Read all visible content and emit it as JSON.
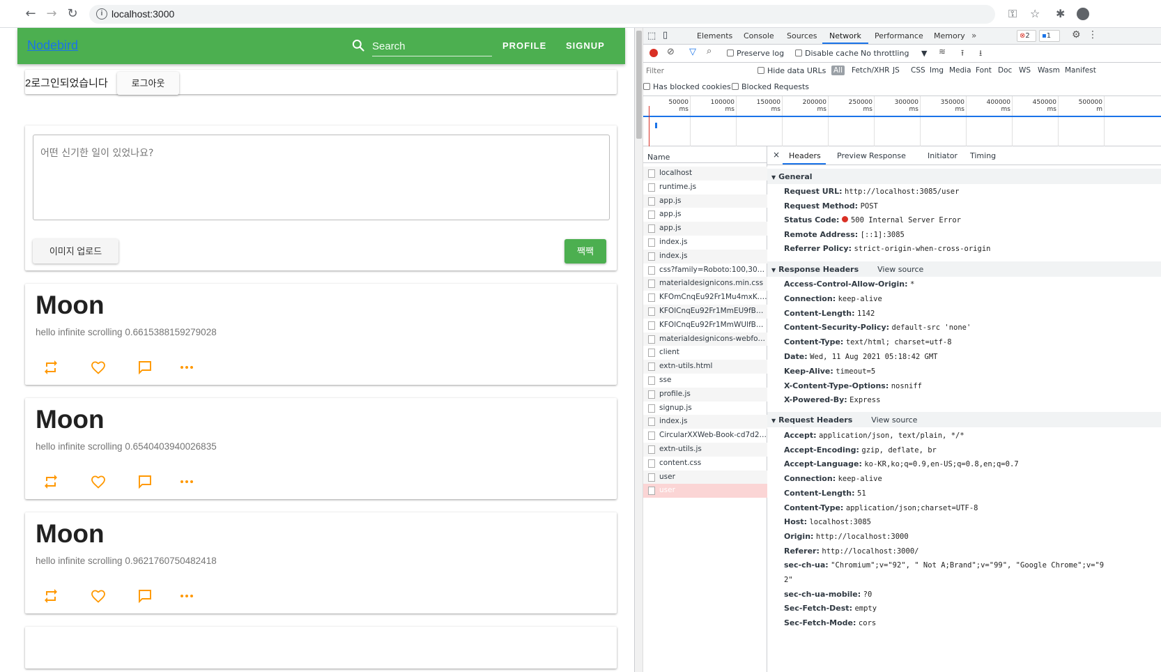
{
  "browser": {
    "url": "localhost:3000"
  },
  "app": {
    "brand": "Nodebird",
    "search_placeholder": "Search",
    "nav": {
      "profile": "PROFILE",
      "signup": "SIGNUP"
    },
    "login_text": "2로그인되었습니다",
    "logout_label": "로그아웃",
    "post_placeholder": "어떤 신기한 일이 있었나요?",
    "upload_label": "이미지 업로드",
    "submit_label": "짹짹",
    "posts": [
      {
        "title": "Moon",
        "body": "hello infinite scrolling 0.6615388159279028"
      },
      {
        "title": "Moon",
        "body": "hello infinite scrolling 0.6540403940026835"
      },
      {
        "title": "Moon",
        "body": "hello infinite scrolling 0.9621760750482418"
      }
    ],
    "colors": {
      "appbar": "#4caf50",
      "accent_icons": "#ff9800"
    }
  },
  "devtools": {
    "tabs": [
      "Elements",
      "Console",
      "Sources",
      "Network",
      "Performance",
      "Memory"
    ],
    "active_tab": "Network",
    "error_count": "2",
    "message_count": "1",
    "toolbar": {
      "preserve_log": "Preserve log",
      "disable_cache": "Disable cache",
      "throttling": "No throttling"
    },
    "filter": {
      "placeholder": "Filter",
      "hide_data_urls": "Hide data URLs",
      "types": [
        "All",
        "Fetch/XHR",
        "JS",
        "CSS",
        "Img",
        "Media",
        "Font",
        "Doc",
        "WS",
        "Wasm",
        "Manifest"
      ],
      "has_blocked_cookies": "Has blocked cookies",
      "blocked_requests": "Blocked Requests"
    },
    "timeline_ticks": [
      "50000 ms",
      "100000 ms",
      "150000 ms",
      "200000 ms",
      "250000 ms",
      "300000 ms",
      "350000 ms",
      "400000 ms",
      "450000 ms",
      "500000 m"
    ],
    "name_header": "Name",
    "requests": [
      "localhost",
      "runtime.js",
      "app.js",
      "app.js",
      "app.js",
      "index.js",
      "index.js",
      "css?family=Roboto:100,300,40...",
      "materialdesignicons.min.css",
      "KFOmCnqEu92Fr1Mu4mxK.wo...",
      "KFOlCnqEu92Fr1MmEU9fBBc4...",
      "KFOlCnqEu92Fr1MmWUlfBBc...",
      "materialdesignicons-webfont....",
      "client",
      "extn-utils.html",
      "sse",
      "profile.js",
      "signup.js",
      "index.js",
      "CircularXXWeb-Book-cd7d2bc...",
      "extn-utils.js",
      "content.css",
      "user",
      "user"
    ],
    "detail_tabs": [
      "Headers",
      "Preview",
      "Response",
      "Initiator",
      "Timing"
    ],
    "general_title": "General",
    "general": [
      {
        "k": "Request URL:",
        "v": "http://localhost:3085/user"
      },
      {
        "k": "Request Method:",
        "v": "POST"
      },
      {
        "k": "Status Code:",
        "v": "500 Internal Server Error"
      },
      {
        "k": "Remote Address:",
        "v": "[::1]:3085"
      },
      {
        "k": "Referrer Policy:",
        "v": "strict-origin-when-cross-origin"
      }
    ],
    "response_title": "Response Headers",
    "view_source": "View source",
    "response_headers": [
      {
        "k": "Access-Control-Allow-Origin:",
        "v": "*"
      },
      {
        "k": "Connection:",
        "v": "keep-alive"
      },
      {
        "k": "Content-Length:",
        "v": "1142"
      },
      {
        "k": "Content-Security-Policy:",
        "v": "default-src 'none'"
      },
      {
        "k": "Content-Type:",
        "v": "text/html; charset=utf-8"
      },
      {
        "k": "Date:",
        "v": "Wed, 11 Aug 2021 05:18:42 GMT"
      },
      {
        "k": "Keep-Alive:",
        "v": "timeout=5"
      },
      {
        "k": "X-Content-Type-Options:",
        "v": "nosniff"
      },
      {
        "k": "X-Powered-By:",
        "v": "Express"
      }
    ],
    "request_title": "Request Headers",
    "request_headers": [
      {
        "k": "Accept:",
        "v": "application/json, text/plain, */*"
      },
      {
        "k": "Accept-Encoding:",
        "v": "gzip, deflate, br"
      },
      {
        "k": "Accept-Language:",
        "v": "ko-KR,ko;q=0.9,en-US;q=0.8,en;q=0.7"
      },
      {
        "k": "Connection:",
        "v": "keep-alive"
      },
      {
        "k": "Content-Length:",
        "v": "51"
      },
      {
        "k": "Content-Type:",
        "v": "application/json;charset=UTF-8"
      },
      {
        "k": "Host:",
        "v": "localhost:3085"
      },
      {
        "k": "Origin:",
        "v": "http://localhost:3000"
      },
      {
        "k": "Referer:",
        "v": "http://localhost:3000/"
      },
      {
        "k": "sec-ch-ua:",
        "v": "\"Chromium\";v=\"92\", \" Not A;Brand\";v=\"99\", \"Google Chrome\";v=\"9"
      },
      {
        "k": "",
        "v": "2\""
      },
      {
        "k": "sec-ch-ua-mobile:",
        "v": "?0"
      },
      {
        "k": "Sec-Fetch-Dest:",
        "v": "empty"
      },
      {
        "k": "Sec-Fetch-Mode:",
        "v": "cors"
      }
    ]
  }
}
